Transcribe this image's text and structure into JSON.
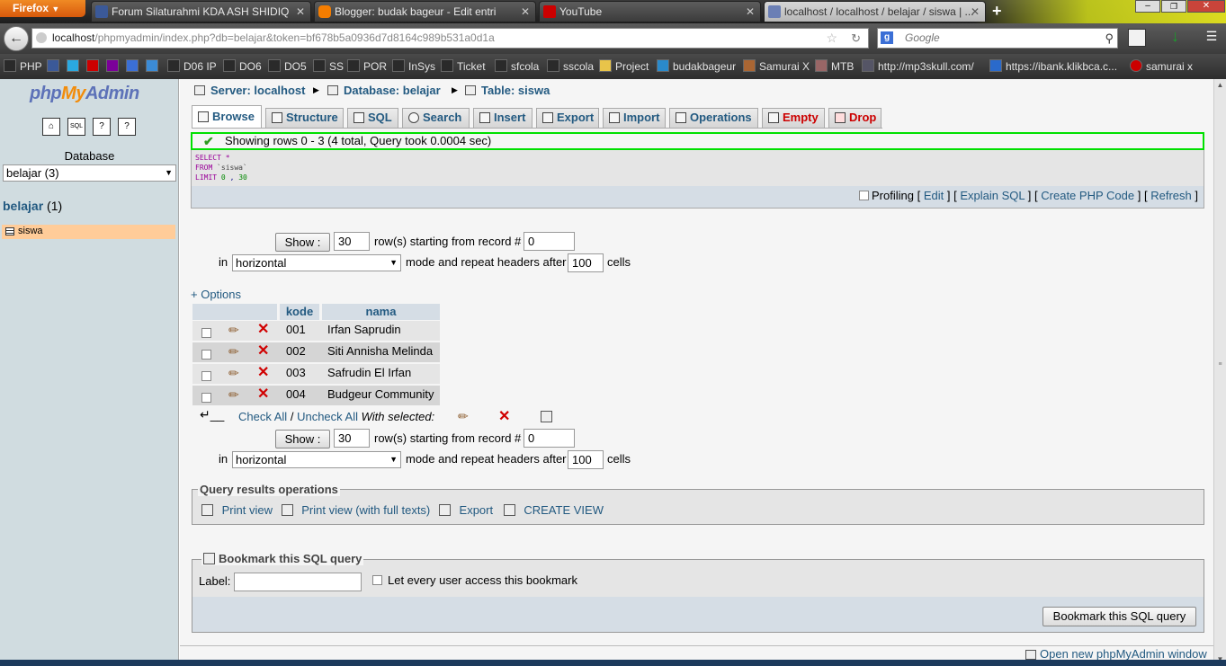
{
  "browser": {
    "menu_label": "Firefox",
    "tabs": [
      {
        "label": "Forum Silaturahmi KDA ASH SHIDIQ",
        "icon": "facebook-icon",
        "color": "#3b5998"
      },
      {
        "label": "Blogger: budak bageur - Edit entri",
        "icon": "blogger-icon",
        "color": "#f57d00"
      },
      {
        "label": "YouTube",
        "icon": "youtube-icon",
        "color": "#cc0000"
      },
      {
        "label": "localhost / localhost / belajar / siswa | ...",
        "icon": "phpmyadmin-icon",
        "color": "#6b7fb5"
      }
    ],
    "new_tab": "+",
    "url_host": "localhost",
    "url_rest": "/phpmyadmin/index.php?db=belajar&token=bf678b5a0936d7d8164c989b531a0d1a",
    "search_placeholder": "Google",
    "bookmarks": [
      "PHP",
      "D06 IP",
      "DO6",
      "DO5",
      "SS",
      "POR",
      "InSys",
      "Ticket",
      "sfcola",
      "sscola",
      "Project",
      "budakbageur",
      "Samurai X",
      "MTB",
      "http://mp3skull.com/",
      "https://ibank.klikbca.c...",
      "samurai x"
    ]
  },
  "left": {
    "logo_php": "php",
    "logo_my": "My",
    "logo_admin": "Admin",
    "database_label": "Database",
    "database_select": "belajar (3)",
    "db_name": "belajar",
    "db_count": "(1)",
    "table_name": "siswa"
  },
  "breadcrumb": {
    "server": "Server: localhost",
    "database": "Database: belajar",
    "table": "Table: siswa"
  },
  "tabs": [
    "Browse",
    "Structure",
    "SQL",
    "Search",
    "Insert",
    "Export",
    "Import",
    "Operations",
    "Empty",
    "Drop"
  ],
  "message": "Showing rows 0 - 3 (4 total, Query took 0.0004 sec)",
  "sql": {
    "select": "SELECT",
    "star": "*",
    "from": "FROM",
    "table": "`siswa`",
    "limit": "LIMIT",
    "offset": "0",
    "comma": ",",
    "count": "30"
  },
  "sqlbar": {
    "profiling": "Profiling",
    "edit": "Edit",
    "explain": "Explain SQL",
    "create_php": "Create PHP Code",
    "refresh": "Refresh",
    "lbracket": "[",
    "rbracket": "]"
  },
  "nav": {
    "show_button": "Show :",
    "rows_value": "30",
    "rows_text": "row(s) starting from record #",
    "start_value": "0",
    "in_text": "in",
    "mode_value": "horizontal",
    "mode_text": "mode and repeat headers after",
    "repeat_value": "100",
    "cells_text": "cells"
  },
  "options_link": "+ Options",
  "table": {
    "headers": [
      "kode",
      "nama"
    ],
    "rows": [
      {
        "kode": "001",
        "nama": "Irfan Saprudin"
      },
      {
        "kode": "002",
        "nama": "Siti Annisha Melinda"
      },
      {
        "kode": "003",
        "nama": "Safrudin El Irfan"
      },
      {
        "kode": "004",
        "nama": "Budgeur Community"
      }
    ]
  },
  "bulk": {
    "check_all": "Check All",
    "separator": "/",
    "uncheck_all": "Uncheck All",
    "with_selected": "With selected:"
  },
  "qro": {
    "legend": "Query results operations",
    "print_view": "Print view",
    "print_view_full": "Print view (with full texts)",
    "export": "Export",
    "create_view": "CREATE VIEW"
  },
  "bookmark": {
    "legend": "Bookmark this SQL query",
    "label": "Label:",
    "label_value": "",
    "every_user": "Let every user access this bookmark",
    "button": "Bookmark this SQL query"
  },
  "footer_link": "Open new phpMyAdmin window"
}
